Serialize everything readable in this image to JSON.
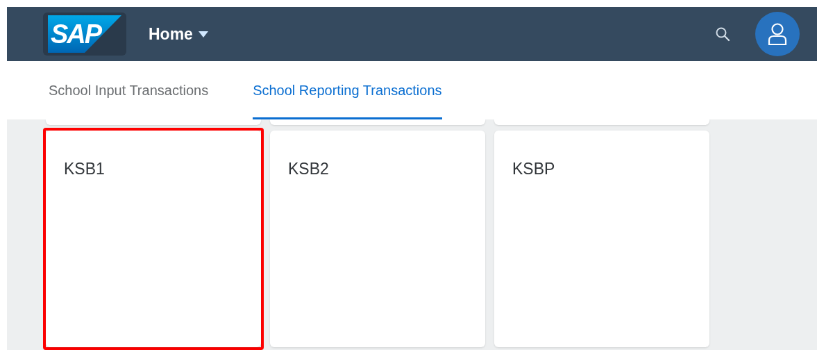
{
  "shell": {
    "logo": "SAP",
    "title": "Home"
  },
  "tabs": [
    {
      "label": "School Input Transactions",
      "selected": false
    },
    {
      "label": "School Reporting Transactions",
      "selected": true
    }
  ],
  "tiles": [
    {
      "title": "KSB1",
      "highlighted": true
    },
    {
      "title": "KSB2",
      "highlighted": false
    },
    {
      "title": "KSBP",
      "highlighted": false
    }
  ]
}
